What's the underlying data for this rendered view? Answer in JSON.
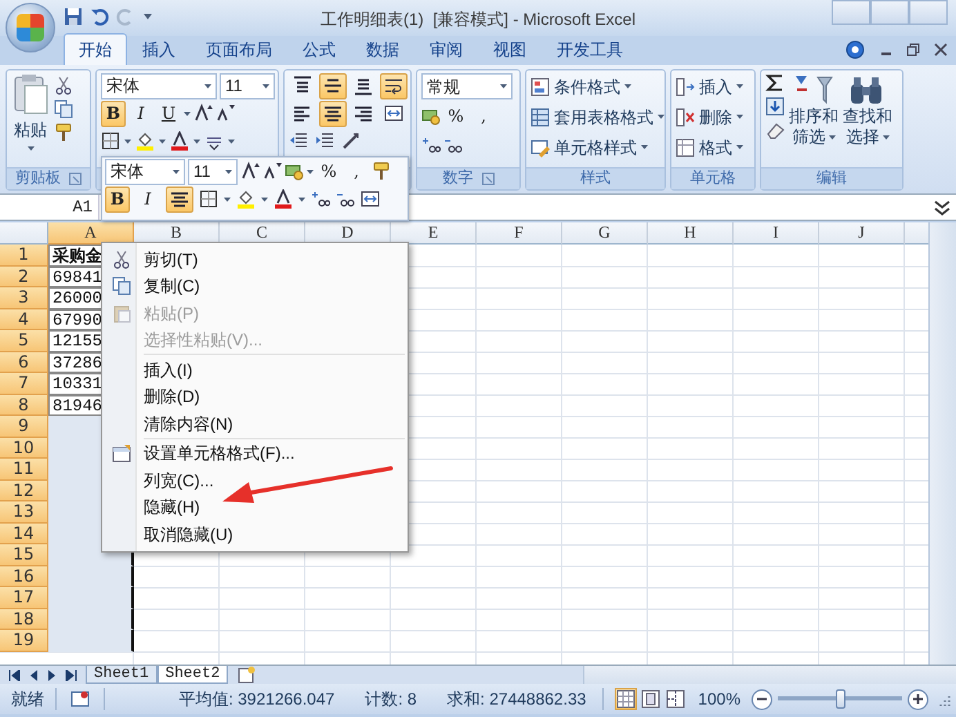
{
  "window": {
    "title": "工作明细表(1)  [兼容模式] - Microsoft Excel"
  },
  "tabs": [
    {
      "label": "开始",
      "selected": true
    },
    {
      "label": "插入",
      "selected": false
    },
    {
      "label": "页面布局",
      "selected": false
    },
    {
      "label": "公式",
      "selected": false
    },
    {
      "label": "数据",
      "selected": false
    },
    {
      "label": "审阅",
      "selected": false
    },
    {
      "label": "视图",
      "selected": false
    },
    {
      "label": "开发工具",
      "selected": false
    }
  ],
  "clipboard": {
    "paste": "粘贴",
    "label": "剪贴板"
  },
  "font": {
    "name": "宋体",
    "size": "11",
    "buttons": [
      {
        "label": "B",
        "on": true
      },
      {
        "label": "I",
        "on": false
      },
      {
        "label": "U",
        "on": false
      }
    ]
  },
  "alignment": {
    "buttons": [
      {
        "kind": "top",
        "on": false
      },
      {
        "kind": "middle",
        "on": true
      },
      {
        "kind": "bottom",
        "on": false
      },
      {
        "kind": "wrap",
        "on": true
      },
      {
        "kind": "left",
        "on": false
      },
      {
        "kind": "center",
        "on": true
      },
      {
        "kind": "right",
        "on": false
      },
      {
        "kind": "merge",
        "on": false
      }
    ]
  },
  "number": {
    "format": "常规",
    "symbols": [
      "%",
      ","
    ],
    "label": "数字"
  },
  "styles": {
    "items": [
      "条件格式",
      "套用表格格式",
      "单元格样式"
    ],
    "label": "样式"
  },
  "cells": {
    "items": [
      "插入",
      "删除",
      "格式"
    ],
    "label": "单元格"
  },
  "editing": {
    "sort": [
      "排序和",
      "筛选"
    ],
    "find": [
      "查找和",
      "选择"
    ],
    "label": "编辑"
  },
  "mini_toolbar": {
    "font": "宋体",
    "size": "11",
    "symbols": [
      "%",
      ","
    ],
    "buttons": [
      {
        "label": "B",
        "on": true
      },
      {
        "label": "I",
        "on": false
      }
    ],
    "center_on": true
  },
  "name_box": "A1",
  "columns": [
    {
      "label": "A",
      "selected": true
    },
    {
      "label": "B",
      "selected": false
    },
    {
      "label": "C",
      "selected": false
    },
    {
      "label": "D",
      "selected": false
    },
    {
      "label": "E",
      "selected": false
    },
    {
      "label": "F",
      "selected": false
    },
    {
      "label": "G",
      "selected": false
    },
    {
      "label": "H",
      "selected": false
    },
    {
      "label": "I",
      "selected": false
    },
    {
      "label": "J",
      "selected": false
    }
  ],
  "rows": [
    {
      "number": "1",
      "selected": true,
      "bold": true,
      "value": "采购金"
    },
    {
      "number": "2",
      "selected": true,
      "bold": false,
      "value": "69841"
    },
    {
      "number": "3",
      "selected": true,
      "bold": false,
      "value": "26000"
    },
    {
      "number": "4",
      "selected": true,
      "bold": false,
      "value": "67990"
    },
    {
      "number": "5",
      "selected": true,
      "bold": false,
      "value": "12155"
    },
    {
      "number": "6",
      "selected": true,
      "bold": false,
      "value": "37286"
    },
    {
      "number": "7",
      "selected": true,
      "bold": false,
      "value": "10331"
    },
    {
      "number": "8",
      "selected": true,
      "bold": false,
      "value": "81946"
    },
    {
      "number": "9",
      "selected": true
    },
    {
      "number": "10",
      "selected": true
    },
    {
      "number": "11",
      "selected": true
    },
    {
      "number": "12",
      "selected": true
    },
    {
      "number": "13",
      "selected": true
    },
    {
      "number": "14",
      "selected": true
    },
    {
      "number": "15",
      "selected": true
    },
    {
      "number": "16",
      "selected": true
    },
    {
      "number": "17",
      "selected": true
    },
    {
      "number": "18",
      "selected": true
    },
    {
      "number": "19",
      "selected": true
    }
  ],
  "context_menu": [
    {
      "kind": "cut",
      "label": "剪切(T)",
      "disabled": false
    },
    {
      "kind": "copy",
      "label": "复制(C)",
      "disabled": false
    },
    {
      "kind": "paste",
      "label": "粘贴(P)",
      "disabled": true
    },
    {
      "kind": "plain",
      "label": "选择性粘贴(V)...",
      "disabled": true
    },
    {
      "kind": "separator"
    },
    {
      "kind": "plain",
      "label": "插入(I)",
      "disabled": false
    },
    {
      "kind": "plain",
      "label": "删除(D)",
      "disabled": false
    },
    {
      "kind": "plain",
      "label": "清除内容(N)",
      "disabled": false
    },
    {
      "kind": "separator"
    },
    {
      "kind": "format",
      "label": "设置单元格格式(F)...",
      "disabled": false
    },
    {
      "kind": "plain",
      "label": "列宽(C)...",
      "disabled": false
    },
    {
      "kind": "plain",
      "label": "隐藏(H)",
      "disabled": false
    },
    {
      "kind": "plain",
      "label": "取消隐藏(U)",
      "disabled": false
    }
  ],
  "sheet_tabs": [
    {
      "label": "Sheet1",
      "selected": false
    },
    {
      "label": "Sheet2",
      "selected": true
    }
  ],
  "status_bar": {
    "state": "就绪",
    "average": "平均值: 3921266.047",
    "count": "计数: 8",
    "sum": "求和: 27448862.33",
    "zoom": "100%",
    "level": 0.5,
    "views": [
      {
        "kind": "normal",
        "selected": true
      },
      {
        "kind": "layout",
        "selected": false
      },
      {
        "kind": "pagebreak",
        "selected": false
      }
    ]
  }
}
